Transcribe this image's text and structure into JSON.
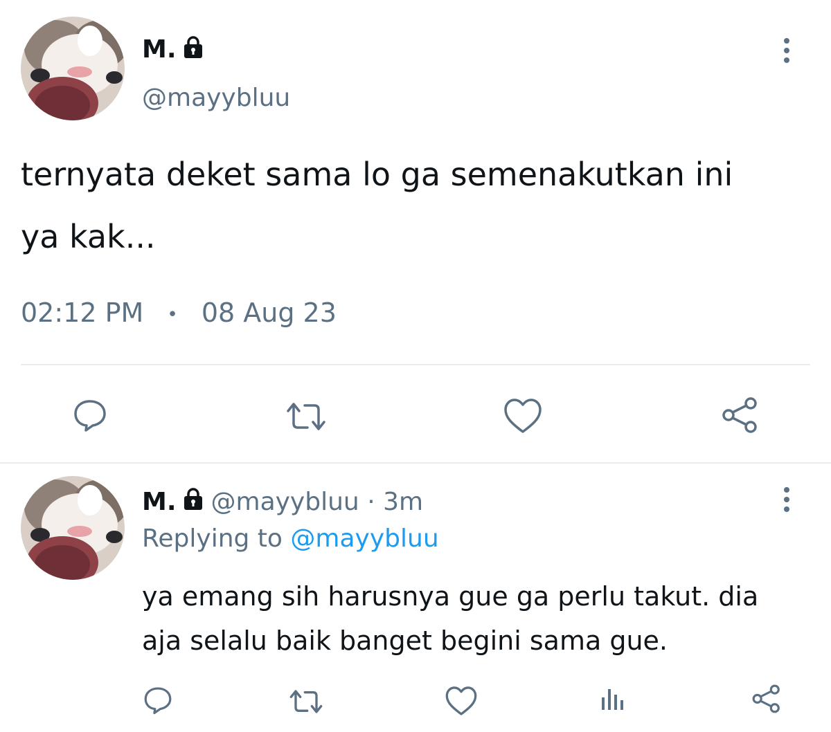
{
  "main_tweet": {
    "display_name": "M.",
    "handle": "@mayybluu",
    "text_line1": "ternyata deket sama lo ga semenakutkan ini",
    "text_line2": "ya kak...",
    "time": "02:12 PM",
    "separator": "•",
    "date": "08 Aug 23",
    "actions": [
      "reply-icon",
      "retweet-icon",
      "like-icon",
      "share-icon"
    ]
  },
  "reply_tweet": {
    "display_name": "M.",
    "handle": "@mayybluu",
    "dot": "·",
    "age": "3m",
    "replying_prefix": "Replying to",
    "replying_handle": "@mayybluu",
    "text_line1": "ya emang sih harusnya gue ga perlu takut. dia",
    "text_line2": "aja selalu baik banget begini sama gue.",
    "actions": [
      "reply-icon",
      "retweet-icon",
      "like-icon",
      "analytics-icon",
      "share-icon"
    ]
  },
  "colors": {
    "text": "#0f1419",
    "muted": "#5b7083",
    "link": "#1d9bf0",
    "divider": "#e7ecf0"
  }
}
